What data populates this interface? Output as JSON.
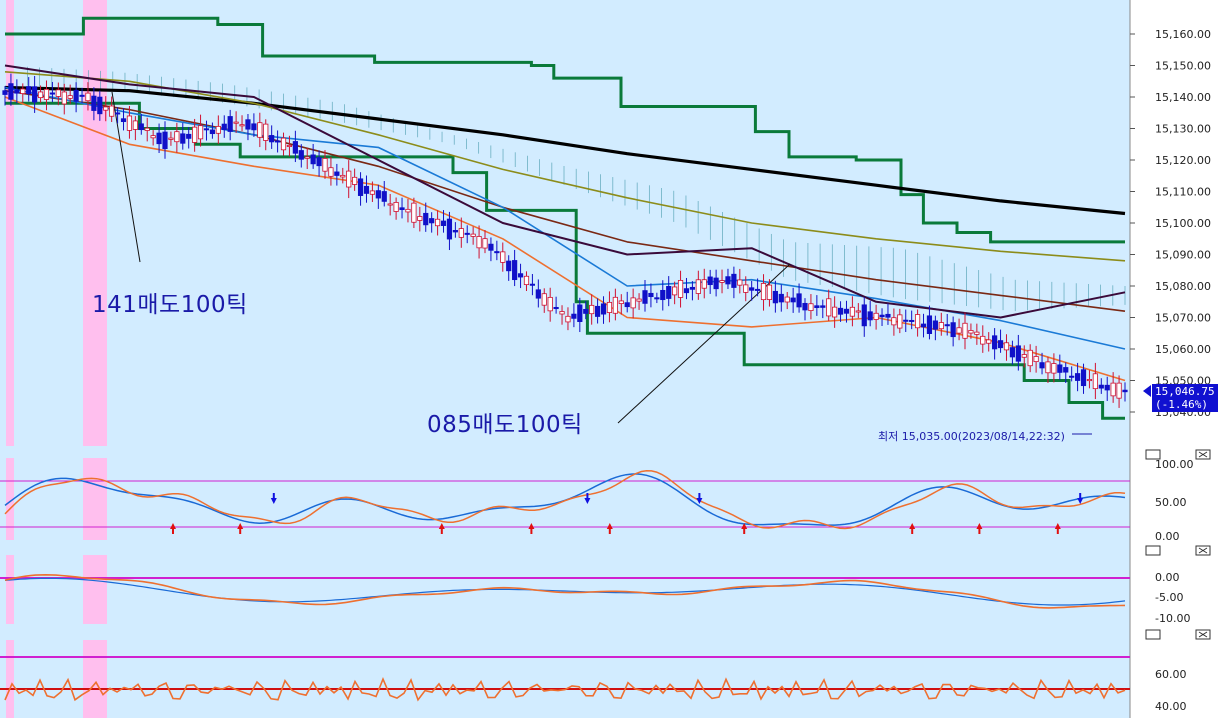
{
  "chart_data": [
    {
      "type": "candlestick",
      "panel": "price",
      "ylim": [
        15035,
        15165
      ],
      "y_ticks": [
        "15,160.00",
        "15,150.00",
        "15,140.00",
        "15,130.00",
        "15,120.00",
        "15,110.00",
        "15,100.00",
        "15,090.00",
        "15,080.00",
        "15,070.00",
        "15,060.00",
        "15,050.00",
        "15,040.00"
      ],
      "last_price": "15,046.75",
      "last_change": "(-1.46%)",
      "low_label": "최저 15,035.00(2023/08/14,22:32)",
      "annotations": [
        "141매도100틱",
        "085매도100틱"
      ],
      "series": [
        {
          "name": "ma_black",
          "values": [
            15143,
            15142,
            15138,
            15133,
            15128,
            15122,
            15117,
            15112,
            15107,
            15103
          ]
        },
        {
          "name": "ma_olive",
          "values": [
            15148,
            15145,
            15138,
            15128,
            15117,
            15108,
            15100,
            15095,
            15091,
            15088
          ]
        },
        {
          "name": "ma_brown",
          "values": [
            15142,
            15136,
            15128,
            15118,
            15105,
            15094,
            15088,
            15082,
            15077,
            15072
          ]
        },
        {
          "name": "ma_blue",
          "values": [
            15143,
            15135,
            15128,
            15124,
            15105,
            15080,
            15082,
            15076,
            15069,
            15060
          ]
        },
        {
          "name": "ma_orange",
          "values": [
            15140,
            15125,
            15118,
            15112,
            15095,
            15070,
            15067,
            15070,
            15062,
            15050
          ]
        }
      ]
    },
    {
      "type": "line",
      "panel": "oscillator_1",
      "y_ticks": [
        "100.00",
        "50.00",
        "0.00"
      ],
      "ylim": [
        0,
        100
      ]
    },
    {
      "type": "line",
      "panel": "oscillator_2",
      "y_ticks": [
        "0.00",
        "-5.00",
        "-10.00"
      ],
      "ylim": [
        -12,
        1
      ]
    },
    {
      "type": "line",
      "panel": "oscillator_3",
      "y_ticks": [
        "60.00",
        "40.00"
      ],
      "ylim": [
        30,
        70
      ]
    }
  ],
  "colors": {
    "plot_bg": "#d2ecff",
    "highlight": "#ffbfee",
    "cloud": "#5aa5b8",
    "baseline_green": "#0a7a3a",
    "ma_black": "#000000",
    "ma_olive": "#8c8c1a",
    "ma_brown": "#7a2814",
    "ma_blue": "#1a7ad6",
    "ma_orange": "#ee7030",
    "candle_up": "#d01030",
    "candle_down": "#1010c8"
  },
  "icons": [
    "panel-restore-icon",
    "panel-close-icon",
    "buy-arrow-icon",
    "sell-arrow-icon"
  ]
}
